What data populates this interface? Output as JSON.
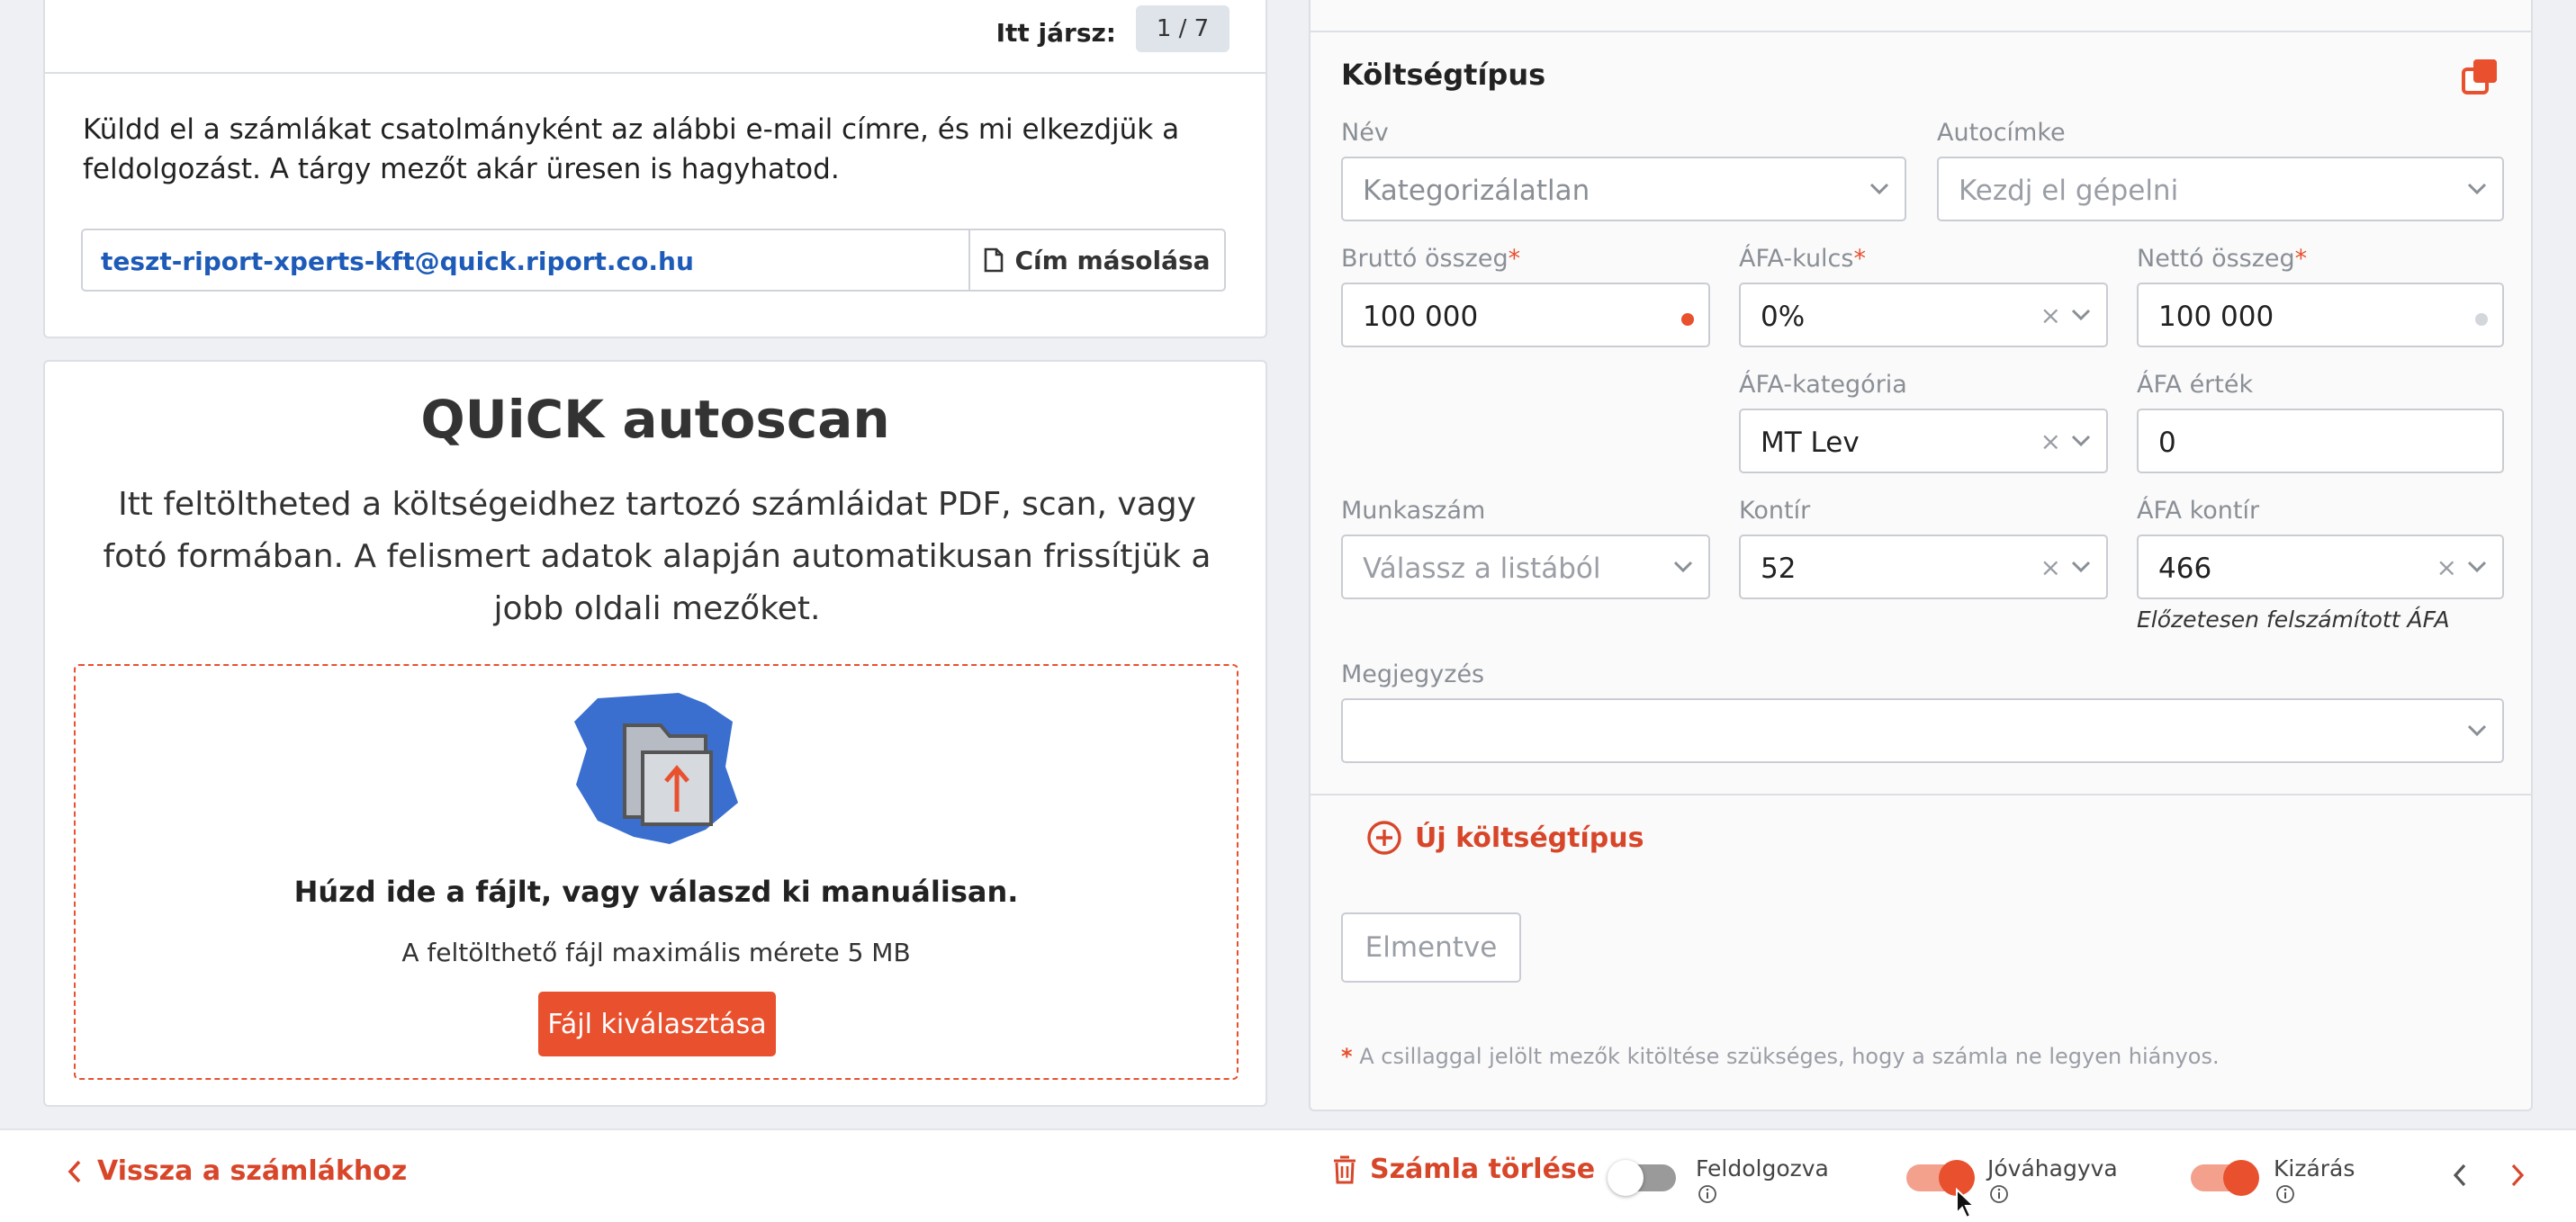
{
  "email_card": {
    "step_label": "Itt jársz:",
    "step_value": "1 / 7",
    "description": "Küldd el a számlákat csatolmányként az alábbi e-mail címre, és mi elkezdjük a feldolgozást. A tárgy mezőt akár üresen is hagyhatod.",
    "email_address": "teszt-riport-xperts-kft@quick.riport.co.hu",
    "copy_button": "Cím másolása"
  },
  "autoscan": {
    "title": "QUiCK autoscan",
    "description": "Itt feltöltheted a költségeidhez tartozó számláidat PDF, scan, vagy fotó formában. A felismert adatok alapján automatikusan frissítjük a jobb oldali mezőket.",
    "drop_title": "Húzd ide a fájlt, vagy válaszd ki manuálisan.",
    "max_size": "A feltölthető fájl maximális mérete 5 MB",
    "select_button": "Fájl kiválasztása"
  },
  "cost_type": {
    "section_title": "Költségtípus",
    "name_label": "Név",
    "name_value": "Kategorizálatlan",
    "autotag_label": "Autocímke",
    "autotag_placeholder": "Kezdj el gépelni",
    "gross_label": "Bruttó összeg",
    "gross_value": "100 000",
    "vat_rate_label": "ÁFA-kulcs",
    "vat_rate_value": "0%",
    "net_label": "Nettó összeg",
    "net_value": "100 000",
    "vat_category_label": "ÁFA-kategória",
    "vat_category_value": "MT Lev",
    "vat_amount_label": "ÁFA érték",
    "vat_amount_value": "0",
    "job_number_label": "Munkaszám",
    "job_number_placeholder": "Válassz a listából",
    "account_label": "Kontír",
    "account_value": "52",
    "vat_account_label": "ÁFA kontír",
    "vat_account_value": "466",
    "vat_account_note": "Előzetesen felszámított ÁFA",
    "comment_label": "Megjegyzés",
    "comment_value": "",
    "required_mark": "*",
    "add_cost_type": "Új költségtípus",
    "save_button": "Elmentve",
    "footnote": "A csillaggal jelölt mezők kitöltése szükséges, hogy a számla ne legyen hiányos."
  },
  "bottom_bar": {
    "back_link": "Vissza a számlákhoz",
    "delete_button": "Számla törlése",
    "processed_label": "Feldolgozva",
    "processed_on": false,
    "approved_label": "Jóváhagyva",
    "approved_on": true,
    "exclusion_label": "Kizárás",
    "exclusion_on": true
  },
  "colors": {
    "accent": "#e8502e",
    "link_blue": "#1e5bb8",
    "upload_icon_blue": "#3a6fd0",
    "muted_text": "#8a8f96"
  },
  "icons": [
    "document-icon",
    "copy-icon",
    "upload-folder-icon",
    "chevron-down-icon",
    "clear-icon",
    "plus-circle-icon",
    "chevron-left-icon",
    "trash-icon",
    "info-icon",
    "chevron-right-icon",
    "mouse-cursor-icon"
  ]
}
